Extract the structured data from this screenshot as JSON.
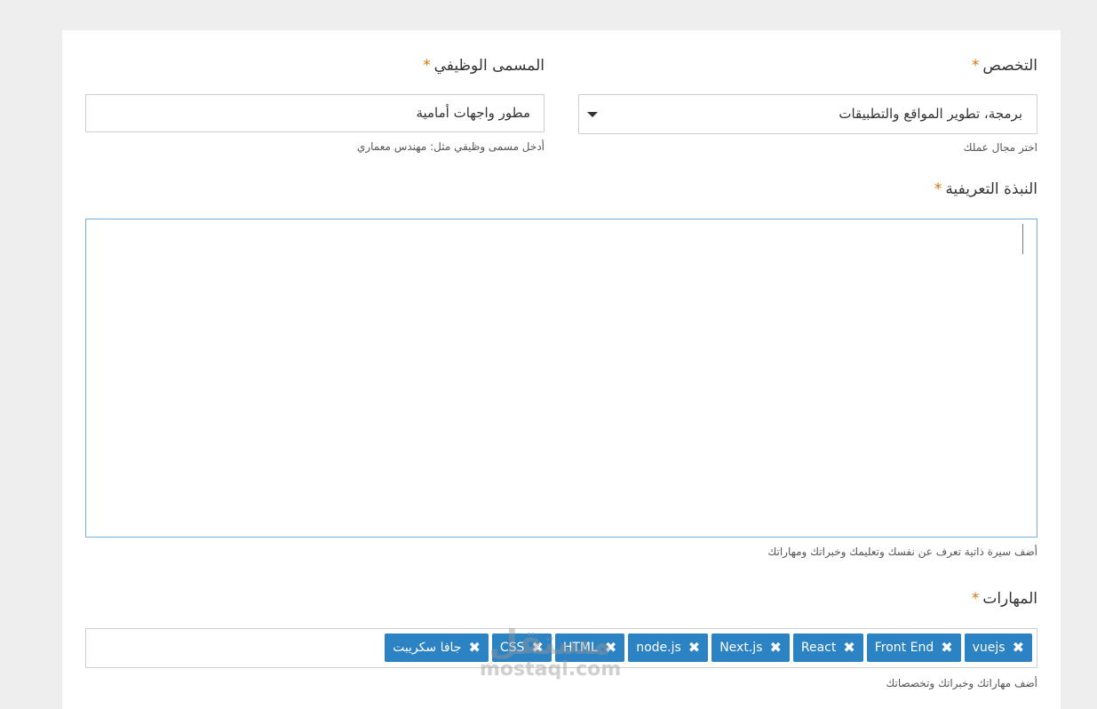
{
  "form": {
    "specialty": {
      "label": "التخصص",
      "required_mark": "*",
      "value": "برمجة، تطوير المواقع والتطبيقات",
      "help": "اختر مجال عملك"
    },
    "job_title": {
      "label": "المسمى الوظيفي",
      "required_mark": "*",
      "value": "مطور واجهات أمامية",
      "help": "أدخل مسمى وظيفي مثل: مهندس معماري"
    },
    "bio": {
      "label": "النبذة التعريفية",
      "required_mark": "*",
      "value": "",
      "help": "أضف سيرة ذاتية تعرف عن نفسك وتعليمك وخبراتك ومهاراتك"
    },
    "skills": {
      "label": "المهارات",
      "required_mark": "*",
      "tags": [
        "vuejs",
        "Front End",
        "React",
        "Next.js",
        "node.js",
        "HTML",
        "CSS",
        "جافا سكريبت"
      ],
      "remove_symbol": "✖",
      "help": "أضف مهاراتك وخبراتك وتخصصاتك"
    }
  },
  "watermark": {
    "arabic": "مستقل",
    "latin": "mostaql.com"
  },
  "colors": {
    "tag_bg": "#2b83c3",
    "required": "#d9730d",
    "focus_border": "#7aaed3"
  }
}
